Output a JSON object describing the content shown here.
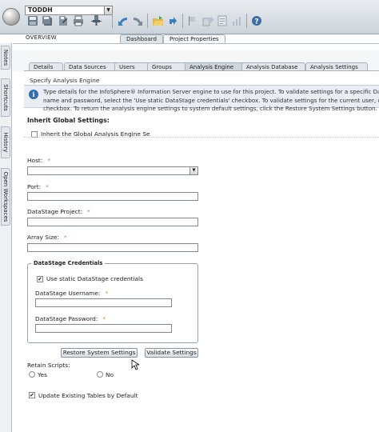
{
  "toolbar": {
    "user": "TODDH"
  },
  "overview_label": "OVERVIEW",
  "page_tabs": [
    "Dashboard",
    "Project Properties"
  ],
  "dock_tabs": [
    "Notes",
    "Shortcuts",
    "History",
    "Open Workspaces"
  ],
  "sub_tabs": [
    "Details",
    "Data Sources",
    "Users",
    "Groups",
    "Analysis Engine",
    "Analysis Database",
    "Analysis Settings"
  ],
  "active_sub_tab": "Analysis Engine",
  "heading": "Specify Analysis Engine",
  "info": {
    "line1": "Type details for the InfoSphere® Information Server engine to use for this project. To validate settings for a specific DataStage",
    "line2": "name and password, select the 'Use static DataStage credentials' checkbox. To validate settings for the current user, clear the",
    "line3": "checkbox. To return the analysis engine settings to system default settings, click the Restore System Settings button."
  },
  "inherit": {
    "title": "Inherit Global Settings:",
    "checkbox_label": "Inherit the Global Analysis Engine Se",
    "checked": false
  },
  "fields": {
    "host_label": "Host:",
    "host_value": "",
    "port_label": "Port:",
    "port_value": "",
    "project_label": "DataStage Project:",
    "project_value": "",
    "array_label": "Array Size:",
    "array_value": "",
    "required_marker": "*"
  },
  "credentials": {
    "legend": "DataStage Credentials",
    "static_label": "Use static DataStage credentials",
    "static_checked": true,
    "username_label": "DataStage Username:",
    "username_value": "",
    "password_label": "DataStage Password:",
    "password_value": ""
  },
  "buttons": {
    "restore": "Restore System Settings",
    "validate": "Validate Settings"
  },
  "retain": {
    "label": "Retain Scripts:",
    "yes": "Yes",
    "no": "No",
    "selected": "none"
  },
  "update_tables": {
    "label": "Update Existing Tables by Default",
    "checked": true
  },
  "colors": {
    "required": "#c9862a",
    "info_bg": "#e8eef4",
    "toolbar_bg": "#ccd3da"
  }
}
